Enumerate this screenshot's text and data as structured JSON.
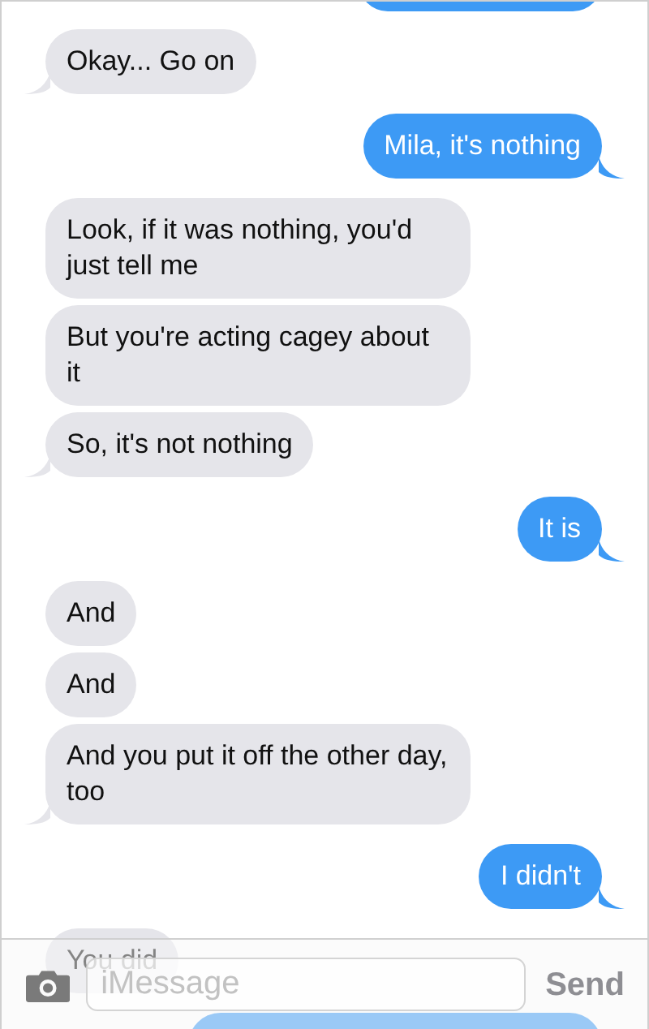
{
  "messages": [
    {
      "kind": "received",
      "text": "Okay... Go on",
      "tail": true
    },
    {
      "kind": "sent",
      "text": "Mila, it's nothing",
      "tail": true
    },
    {
      "kind": "received",
      "text": "Look, if it was nothing, you'd just tell me",
      "tail": false
    },
    {
      "kind": "received",
      "text": "But you're acting cagey about it",
      "tail": false
    },
    {
      "kind": "received",
      "text": "So, it's not nothing",
      "tail": true
    },
    {
      "kind": "sent",
      "text": "It is",
      "tail": true
    },
    {
      "kind": "received",
      "text": "And",
      "tail": false
    },
    {
      "kind": "received",
      "text": "And",
      "tail": false
    },
    {
      "kind": "received",
      "text": "And you put it off the other day, too",
      "tail": true
    },
    {
      "kind": "sent",
      "text": "I didn't",
      "tail": true
    },
    {
      "kind": "received",
      "text": "You did"
    }
  ],
  "composer": {
    "placeholder": "iMessage",
    "send": "Send"
  }
}
